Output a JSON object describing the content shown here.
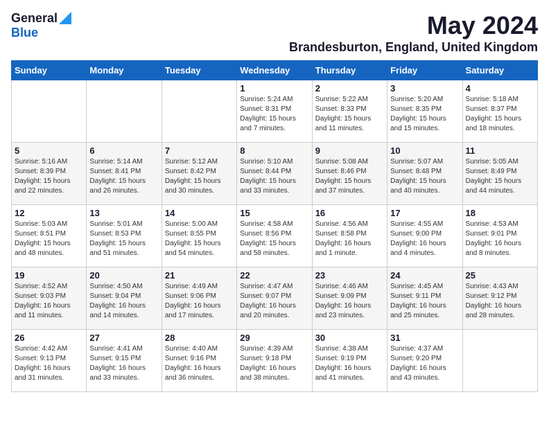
{
  "logo": {
    "general": "General",
    "blue": "Blue"
  },
  "title": "May 2024",
  "subtitle": "Brandesburton, England, United Kingdom",
  "days_of_week": [
    "Sunday",
    "Monday",
    "Tuesday",
    "Wednesday",
    "Thursday",
    "Friday",
    "Saturday"
  ],
  "weeks": [
    [
      {
        "day": "",
        "sunrise": "",
        "sunset": "",
        "daylight": "",
        "empty": true
      },
      {
        "day": "",
        "sunrise": "",
        "sunset": "",
        "daylight": "",
        "empty": true
      },
      {
        "day": "",
        "sunrise": "",
        "sunset": "",
        "daylight": "",
        "empty": true
      },
      {
        "day": "1",
        "sunrise": "Sunrise: 5:24 AM",
        "sunset": "Sunset: 8:31 PM",
        "daylight": "Daylight: 15 hours and 7 minutes."
      },
      {
        "day": "2",
        "sunrise": "Sunrise: 5:22 AM",
        "sunset": "Sunset: 8:33 PM",
        "daylight": "Daylight: 15 hours and 11 minutes."
      },
      {
        "day": "3",
        "sunrise": "Sunrise: 5:20 AM",
        "sunset": "Sunset: 8:35 PM",
        "daylight": "Daylight: 15 hours and 15 minutes."
      },
      {
        "day": "4",
        "sunrise": "Sunrise: 5:18 AM",
        "sunset": "Sunset: 8:37 PM",
        "daylight": "Daylight: 15 hours and 18 minutes."
      }
    ],
    [
      {
        "day": "5",
        "sunrise": "Sunrise: 5:16 AM",
        "sunset": "Sunset: 8:39 PM",
        "daylight": "Daylight: 15 hours and 22 minutes."
      },
      {
        "day": "6",
        "sunrise": "Sunrise: 5:14 AM",
        "sunset": "Sunset: 8:41 PM",
        "daylight": "Daylight: 15 hours and 26 minutes."
      },
      {
        "day": "7",
        "sunrise": "Sunrise: 5:12 AM",
        "sunset": "Sunset: 8:42 PM",
        "daylight": "Daylight: 15 hours and 30 minutes."
      },
      {
        "day": "8",
        "sunrise": "Sunrise: 5:10 AM",
        "sunset": "Sunset: 8:44 PM",
        "daylight": "Daylight: 15 hours and 33 minutes."
      },
      {
        "day": "9",
        "sunrise": "Sunrise: 5:08 AM",
        "sunset": "Sunset: 8:46 PM",
        "daylight": "Daylight: 15 hours and 37 minutes."
      },
      {
        "day": "10",
        "sunrise": "Sunrise: 5:07 AM",
        "sunset": "Sunset: 8:48 PM",
        "daylight": "Daylight: 15 hours and 40 minutes."
      },
      {
        "day": "11",
        "sunrise": "Sunrise: 5:05 AM",
        "sunset": "Sunset: 8:49 PM",
        "daylight": "Daylight: 15 hours and 44 minutes."
      }
    ],
    [
      {
        "day": "12",
        "sunrise": "Sunrise: 5:03 AM",
        "sunset": "Sunset: 8:51 PM",
        "daylight": "Daylight: 15 hours and 48 minutes."
      },
      {
        "day": "13",
        "sunrise": "Sunrise: 5:01 AM",
        "sunset": "Sunset: 8:53 PM",
        "daylight": "Daylight: 15 hours and 51 minutes."
      },
      {
        "day": "14",
        "sunrise": "Sunrise: 5:00 AM",
        "sunset": "Sunset: 8:55 PM",
        "daylight": "Daylight: 15 hours and 54 minutes."
      },
      {
        "day": "15",
        "sunrise": "Sunrise: 4:58 AM",
        "sunset": "Sunset: 8:56 PM",
        "daylight": "Daylight: 15 hours and 58 minutes."
      },
      {
        "day": "16",
        "sunrise": "Sunrise: 4:56 AM",
        "sunset": "Sunset: 8:58 PM",
        "daylight": "Daylight: 16 hours and 1 minute."
      },
      {
        "day": "17",
        "sunrise": "Sunrise: 4:55 AM",
        "sunset": "Sunset: 9:00 PM",
        "daylight": "Daylight: 16 hours and 4 minutes."
      },
      {
        "day": "18",
        "sunrise": "Sunrise: 4:53 AM",
        "sunset": "Sunset: 9:01 PM",
        "daylight": "Daylight: 16 hours and 8 minutes."
      }
    ],
    [
      {
        "day": "19",
        "sunrise": "Sunrise: 4:52 AM",
        "sunset": "Sunset: 9:03 PM",
        "daylight": "Daylight: 16 hours and 11 minutes."
      },
      {
        "day": "20",
        "sunrise": "Sunrise: 4:50 AM",
        "sunset": "Sunset: 9:04 PM",
        "daylight": "Daylight: 16 hours and 14 minutes."
      },
      {
        "day": "21",
        "sunrise": "Sunrise: 4:49 AM",
        "sunset": "Sunset: 9:06 PM",
        "daylight": "Daylight: 16 hours and 17 minutes."
      },
      {
        "day": "22",
        "sunrise": "Sunrise: 4:47 AM",
        "sunset": "Sunset: 9:07 PM",
        "daylight": "Daylight: 16 hours and 20 minutes."
      },
      {
        "day": "23",
        "sunrise": "Sunrise: 4:46 AM",
        "sunset": "Sunset: 9:09 PM",
        "daylight": "Daylight: 16 hours and 23 minutes."
      },
      {
        "day": "24",
        "sunrise": "Sunrise: 4:45 AM",
        "sunset": "Sunset: 9:11 PM",
        "daylight": "Daylight: 16 hours and 25 minutes."
      },
      {
        "day": "25",
        "sunrise": "Sunrise: 4:43 AM",
        "sunset": "Sunset: 9:12 PM",
        "daylight": "Daylight: 16 hours and 28 minutes."
      }
    ],
    [
      {
        "day": "26",
        "sunrise": "Sunrise: 4:42 AM",
        "sunset": "Sunset: 9:13 PM",
        "daylight": "Daylight: 16 hours and 31 minutes."
      },
      {
        "day": "27",
        "sunrise": "Sunrise: 4:41 AM",
        "sunset": "Sunset: 9:15 PM",
        "daylight": "Daylight: 16 hours and 33 minutes."
      },
      {
        "day": "28",
        "sunrise": "Sunrise: 4:40 AM",
        "sunset": "Sunset: 9:16 PM",
        "daylight": "Daylight: 16 hours and 36 minutes."
      },
      {
        "day": "29",
        "sunrise": "Sunrise: 4:39 AM",
        "sunset": "Sunset: 9:18 PM",
        "daylight": "Daylight: 16 hours and 38 minutes."
      },
      {
        "day": "30",
        "sunrise": "Sunrise: 4:38 AM",
        "sunset": "Sunset: 9:19 PM",
        "daylight": "Daylight: 16 hours and 41 minutes."
      },
      {
        "day": "31",
        "sunrise": "Sunrise: 4:37 AM",
        "sunset": "Sunset: 9:20 PM",
        "daylight": "Daylight: 16 hours and 43 minutes."
      },
      {
        "day": "",
        "sunrise": "",
        "sunset": "",
        "daylight": "",
        "empty": true
      }
    ]
  ]
}
